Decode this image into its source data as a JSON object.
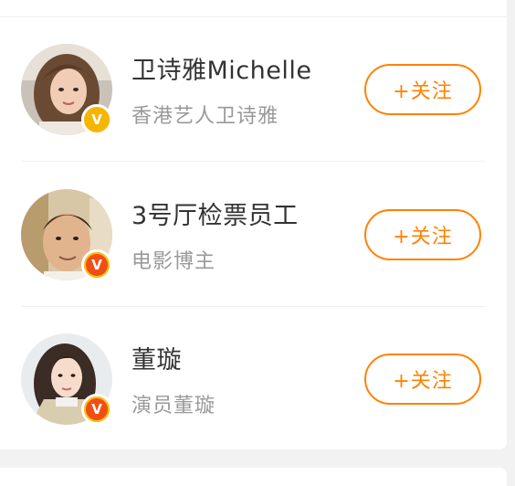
{
  "users": [
    {
      "name": "卫诗雅Michelle",
      "description": "香港艺人卫诗雅",
      "follow_label": "+关注",
      "badge_icon": "verified-v-icon",
      "badge_text": "V",
      "badge_color": "#f7b500"
    },
    {
      "name": "3号厅检票员工",
      "description": "电影博主",
      "follow_label": "+关注",
      "badge_icon": "verified-v-icon",
      "badge_text": "V",
      "badge_color": "#f04e14"
    },
    {
      "name": "董璇",
      "description": "演员董璇",
      "follow_label": "+关注",
      "badge_icon": "verified-v-icon",
      "badge_text": "V",
      "badge_color": "#f04e14"
    }
  ],
  "colors": {
    "accent": "#ff8200",
    "name_text": "#333333",
    "desc_text": "#999999",
    "page_background": "#f2f2f2"
  }
}
